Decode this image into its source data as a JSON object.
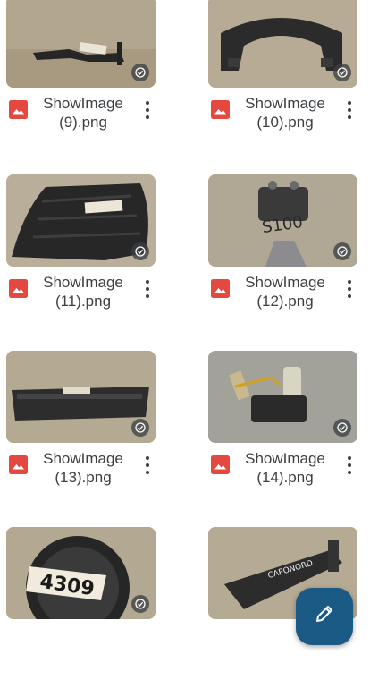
{
  "files": [
    {
      "name_line1": "ShowImage",
      "name_line2": "(9).png",
      "label": "",
      "status": "synced"
    },
    {
      "name_line1": "ShowImage",
      "name_line2": "(10).png",
      "label": "",
      "status": "synced"
    },
    {
      "name_line1": "ShowImage",
      "name_line2": "(11).png",
      "label": "",
      "status": "synced"
    },
    {
      "name_line1": "ShowImage",
      "name_line2": "(12).png",
      "label": "S100",
      "status": "synced"
    },
    {
      "name_line1": "ShowImage",
      "name_line2": "(13).png",
      "label": "",
      "status": "synced"
    },
    {
      "name_line1": "ShowImage",
      "name_line2": "(14).png",
      "label": "",
      "status": "synced"
    },
    {
      "name_line1": "",
      "name_line2": "",
      "label": "4309",
      "status": "synced"
    },
    {
      "name_line1": "",
      "name_line2": "",
      "label": "CAPONORD",
      "status": ""
    }
  ],
  "icons": {
    "file_type": "image-file-icon",
    "menu": "more-vert-icon",
    "status": "offline-check-icon",
    "fab": "edit-pencil-icon"
  },
  "colors": {
    "file_icon": "#e5483f",
    "fab": "#1a5a85",
    "text": "#3c4043"
  }
}
